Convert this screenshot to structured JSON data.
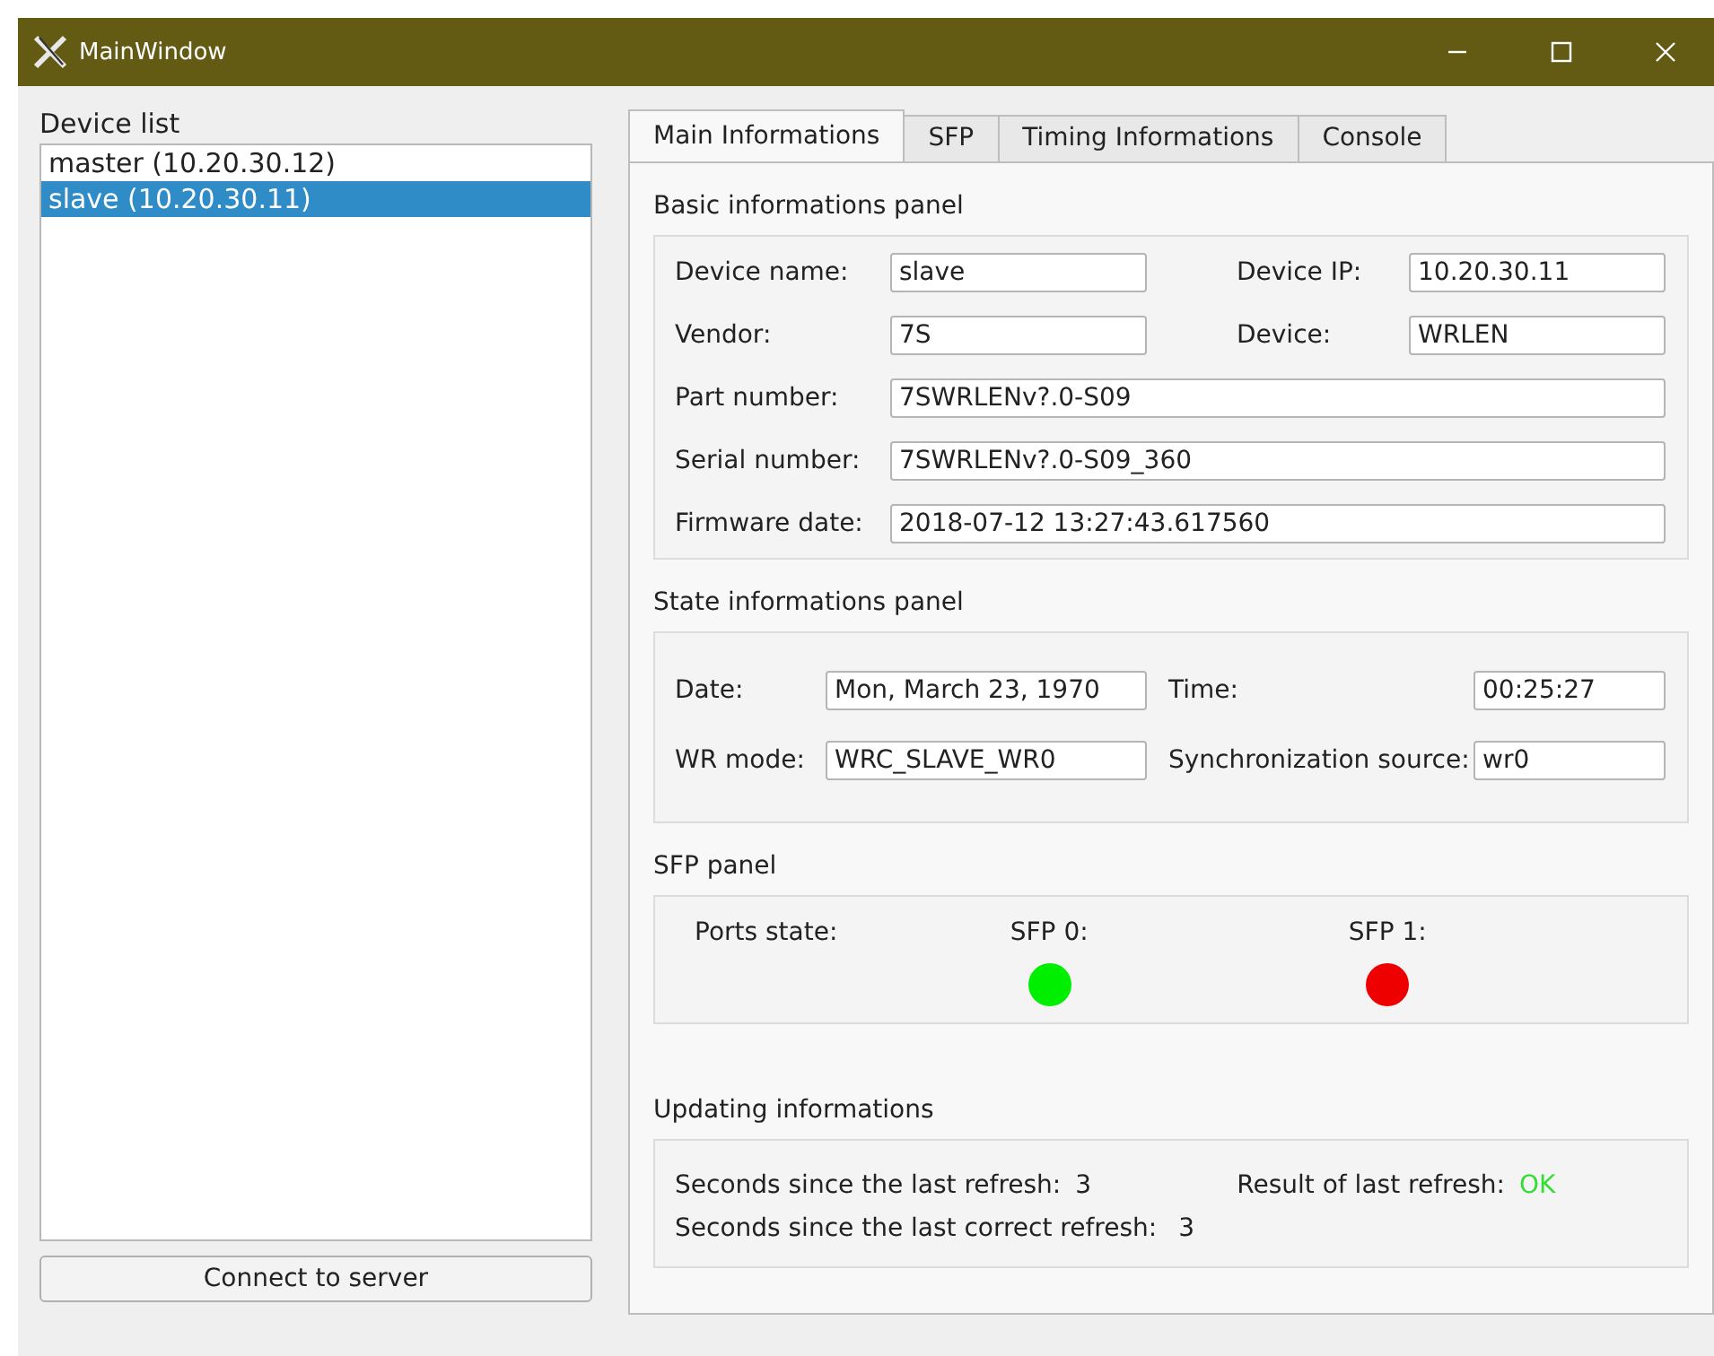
{
  "window": {
    "title": "MainWindow"
  },
  "device_list": {
    "label": "Device list",
    "items": [
      {
        "text": "master (10.20.30.12)",
        "selected": false
      },
      {
        "text": "slave (10.20.30.11)",
        "selected": true
      }
    ],
    "connect_button": "Connect to server"
  },
  "tabs": [
    {
      "label": "Main Informations",
      "selected": true
    },
    {
      "label": "SFP",
      "selected": false
    },
    {
      "label": "Timing Informations",
      "selected": false
    },
    {
      "label": "Console",
      "selected": false
    }
  ],
  "basic_panel": {
    "title": "Basic informations panel",
    "rows": [
      [
        {
          "label": "Device name:",
          "value": "slave"
        },
        {
          "label": "Device IP:",
          "value": "10.20.30.11"
        }
      ],
      [
        {
          "label": "Vendor:",
          "value": "7S"
        },
        {
          "label": "Device:",
          "value": "WRLEN"
        }
      ],
      [
        {
          "label": "Part number:",
          "value": "7SWRLENv?.0-S09"
        }
      ],
      [
        {
          "label": "Serial number:",
          "value": "7SWRLENv?.0-S09_360"
        }
      ],
      [
        {
          "label": "Firmware date:",
          "value": "2018-07-12 13:27:43.617560"
        }
      ]
    ]
  },
  "state_panel": {
    "title": "State informations panel",
    "rows": [
      [
        {
          "label": "Date:",
          "value": "Mon, March 23, 1970"
        },
        {
          "label": "Time:",
          "value": "00:25:27"
        }
      ],
      [
        {
          "label": "WR mode:",
          "value": "WRC_SLAVE_WR0"
        },
        {
          "label": "Synchronization source:",
          "value": "wr0"
        }
      ]
    ]
  },
  "sfp_panel": {
    "title": "SFP panel",
    "label": "Ports state:",
    "ports": [
      {
        "label": "SFP 0:",
        "color": "#00ee00"
      },
      {
        "label": "SFP 1:",
        "color": "#ee0000"
      }
    ]
  },
  "updating_panel": {
    "title": "Updating informations",
    "last_refresh": {
      "label": "Seconds since the last refresh:",
      "value": "3"
    },
    "last_correct_refresh": {
      "label": "Seconds since the last correct refresh:",
      "value": "3"
    },
    "result": {
      "label": "Result of last refresh:",
      "value": "OK"
    }
  }
}
